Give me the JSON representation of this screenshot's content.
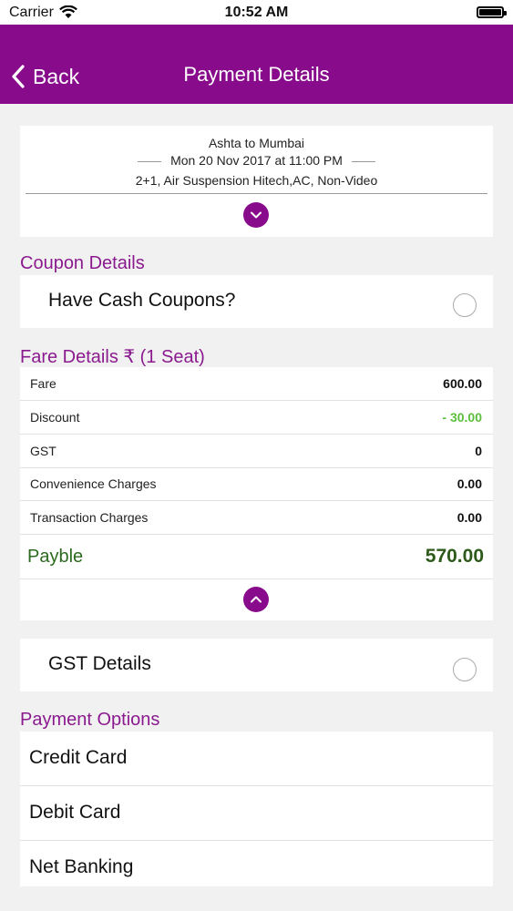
{
  "status_bar": {
    "carrier": "Carrier",
    "time": "10:52 AM"
  },
  "nav": {
    "back_label": "Back",
    "title": "Payment Details"
  },
  "trip": {
    "route": "Ashta to Mumbai",
    "datetime": "Mon 20 Nov 2017 at 11:00 PM",
    "bus_type": "2+1, Air Suspension Hitech,AC, Non-Video"
  },
  "coupon": {
    "section_title": "Coupon Details",
    "label": "Have Cash Coupons?"
  },
  "fare": {
    "section_title": "Fare Details ₹ (1 Seat)",
    "rows": [
      {
        "label": "Fare",
        "value": "600.00"
      },
      {
        "label": "Discount",
        "value": "- 30.00"
      },
      {
        "label": "GST",
        "value": "0"
      },
      {
        "label": "Convenience Charges",
        "value": "0.00"
      },
      {
        "label": "Transaction Charges",
        "value": "0.00"
      }
    ],
    "payable_label": "Payble",
    "payable_value": "570.00"
  },
  "gst": {
    "label": "GST Details"
  },
  "payment_options": {
    "section_title": "Payment Options",
    "items": [
      {
        "label": "Credit Card"
      },
      {
        "label": "Debit Card"
      },
      {
        "label": "Net Banking"
      }
    ]
  },
  "colors": {
    "brand": "#880b8c",
    "discount": "#5bbf3b",
    "payable": "#2d5a1a"
  }
}
